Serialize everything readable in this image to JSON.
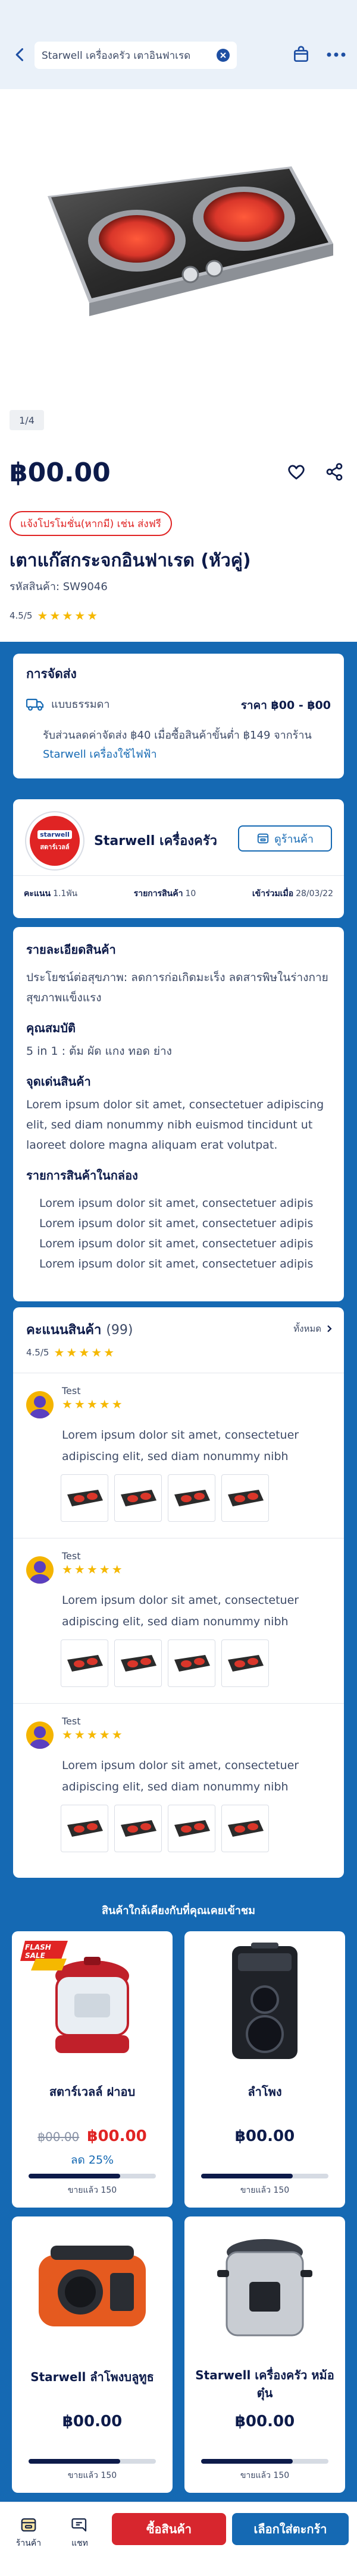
{
  "header": {
    "search_value": "Starwell เครื่องครัว เตาอินฟาเรด",
    "back_icon": "chevron-left-icon",
    "bag_icon": "shopping-bag-icon",
    "more_icon": "more-dots-icon"
  },
  "gallery": {
    "pager": "1/4"
  },
  "product": {
    "price": "฿00.00",
    "promo": "แจ้งโปรโมชั่น(หากมี) เช่น ส่งฟรี",
    "title": "เตาแก๊สกระจกอินฟาเรด (หัวคู่)",
    "sku": "รหัสสินค้า: SW9046",
    "rating": "4.5/5",
    "stars": "★★★★★"
  },
  "shipping": {
    "heading": "การจัดส่ง",
    "method": "แบบธรรมดา",
    "price": "ราคา ฿00 - ฿00",
    "note_prefix": "รับส่วนลดค่าจัดส่ง ฿40 เมื่อซื้อสินค้าขั้นต่ำ ฿149 จากร้าน",
    "note_link": "Starwell เครื่องใช้ไฟฟ้า"
  },
  "shop": {
    "logo_text_top": "starwell",
    "logo_text_bottom": "สตาร์เวลล์",
    "name": "Starwell เครื่องครัว",
    "view_label": "ดูร้านค้า",
    "score_label": "คะแนน",
    "score_value": "1.1พัน",
    "items_label": "รายการสินค้า",
    "items_value": "10",
    "joined_label": "เข้าร่วมเมื่อ",
    "joined_value": "28/03/22"
  },
  "details": {
    "heading": "รายละเอียดสินค้า",
    "intro": "ประโยชน์ต่อสุขภาพ: ลดการก่อเกิดมะเร็ง ลดสารพิษในร่างกาย สุขภาพแข็งแรง",
    "props_heading": "คุณสมบัติ",
    "props": "5 in 1 : ต้ม ผัด แกง ทอด ย่าง",
    "highlights_heading": "จุดเด่นสินค้า",
    "highlights": "Lorem ipsum dolor sit amet, consectetuer adipiscing elit, sed diam nonummy nibh euismod tincidunt ut laoreet dolore magna aliquam erat volutpat.",
    "box_heading": "รายการสินค้าในกล่อง",
    "box_items": [
      "Lorem ipsum dolor sit amet, consectetuer adipis",
      "Lorem ipsum dolor sit amet, consectetuer adipis",
      "Lorem ipsum dolor sit amet, consectetuer adipis",
      "Lorem ipsum dolor sit amet, consectetuer adipis"
    ]
  },
  "reviews": {
    "heading": "คะแนนสินค้า",
    "count": "(99)",
    "see_all": "ทั้งหมด",
    "score": "4.5/5",
    "stars": "★★★★★",
    "items": [
      {
        "name": "Test",
        "stars": "★★★★★",
        "text": "Lorem ipsum dolor sit amet, consectetuer adipiscing elit, sed diam nonummy nibh"
      },
      {
        "name": "Test",
        "stars": "★★★★★",
        "text": "Lorem ipsum dolor sit amet, consectetuer adipiscing elit, sed diam nonummy nibh"
      },
      {
        "name": "Test",
        "stars": "★★★★★",
        "text": "Lorem ipsum dolor sit amet, consectetuer adipiscing elit, sed diam nonummy nibh"
      }
    ]
  },
  "recommend": {
    "heading": "สินค้าใกล้เคียงกับที่คุณเคยเข้าชม",
    "products": [
      {
        "name": "สตาร์เวลล์ ฝาอบ",
        "old_price": "฿00.00",
        "price": "฿00.00",
        "discount": "ลด 25%",
        "sold": "ขายแล้ว 150",
        "sold_fraction": 0.72,
        "badge": "FLASH SALE"
      },
      {
        "name": "ลำโพง",
        "price": "฿00.00",
        "sold": "ขายแล้ว 150",
        "sold_fraction": 0.72
      },
      {
        "name": "Starwell ลำโพงบลูทูธ",
        "price": "฿00.00",
        "sold": "ขายแล้ว 150",
        "sold_fraction": 0.72
      },
      {
        "name": "Starwell เครื่องครัว หม้อตุ๋น",
        "price": "฿00.00",
        "sold": "ขายแล้ว 150",
        "sold_fraction": 0.72
      }
    ]
  },
  "bottom_bar": {
    "shop_label": "ร้านค้า",
    "chat_label": "แชท",
    "buy_label": "ซื้อสินค้า",
    "cart_label": "เลือกใส่ตะกร้า"
  },
  "colors": {
    "accent_blue": "#1569b3",
    "navy": "#0d1b4a",
    "red": "#d7262e",
    "star": "#f5b800"
  }
}
